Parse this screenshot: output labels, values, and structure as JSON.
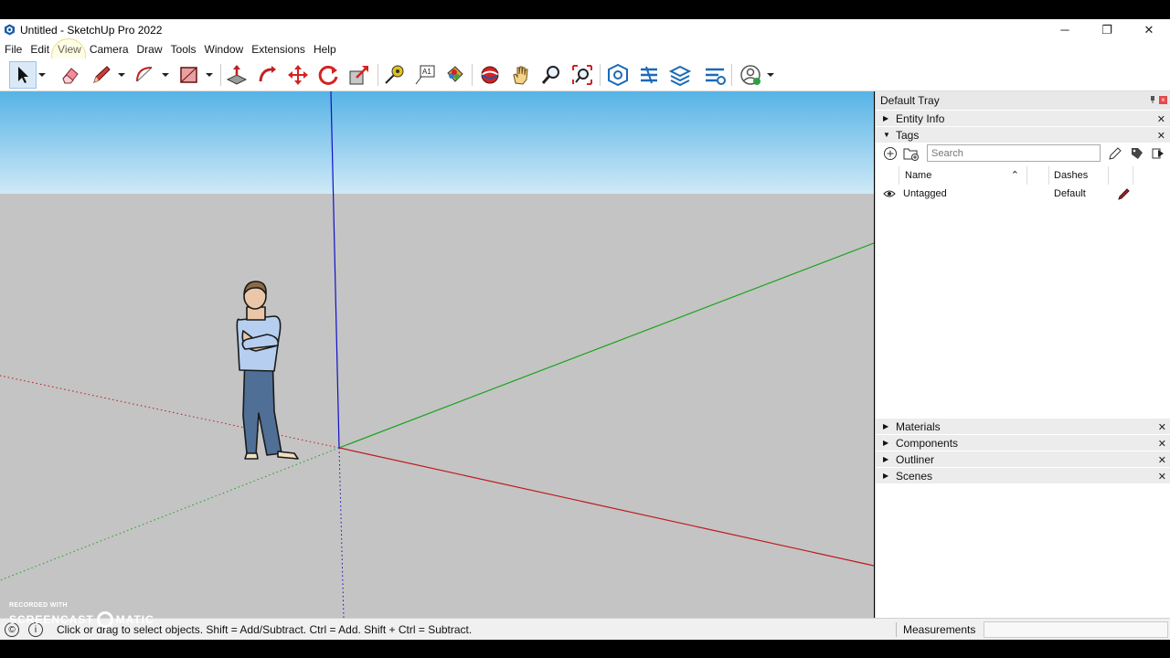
{
  "window": {
    "title": "Untitled - SketchUp Pro 2022",
    "minimize": "─",
    "restore": "❐",
    "close": "✕"
  },
  "menu": [
    "File",
    "Edit",
    "View",
    "Camera",
    "Draw",
    "Tools",
    "Window",
    "Extensions",
    "Help"
  ],
  "toolbar": {
    "tools": [
      "select-icon",
      "eraser-icon",
      "pencil-icon",
      "arc-icon",
      "rectangle-icon",
      "push-pull-icon",
      "follow-me-icon",
      "move-icon",
      "rotate-icon",
      "scale-icon",
      "tape-measure-icon",
      "text-icon",
      "paint-bucket-icon",
      "orbit-icon",
      "pan-icon",
      "zoom-icon",
      "zoom-extents-icon",
      "warehouse-icon",
      "extension-warehouse-icon",
      "layout-icon",
      "extension-manager-icon",
      "account-icon"
    ]
  },
  "tray": {
    "title": "Default Tray",
    "panels_top": [
      {
        "label": "Entity Info",
        "expanded": false
      },
      {
        "label": "Tags",
        "expanded": true
      }
    ],
    "tags": {
      "search_placeholder": "Search",
      "columns": {
        "name": "Name",
        "dashes": "Dashes"
      },
      "rows": [
        {
          "name": "Untagged",
          "dashes": "Default"
        }
      ]
    },
    "panels_bottom": [
      {
        "label": "Materials"
      },
      {
        "label": "Components"
      },
      {
        "label": "Outliner"
      },
      {
        "label": "Scenes"
      }
    ]
  },
  "status": {
    "hint": "Click or drag to select objects. Shift = Add/Subtract. Ctrl = Add. Shift + Ctrl = Subtract.",
    "measurements_label": "Measurements",
    "measurements_value": ""
  },
  "watermark": {
    "line1": "RECORDED WITH",
    "line2a": "SCREENCAST",
    "line2b": "MATIC"
  },
  "colors": {
    "sky_top": "#56b3e6",
    "sky_bottom": "#cfe9f7",
    "ground": "#c4c4c4",
    "axis_red": "#c0171b",
    "axis_green": "#1aa21a",
    "axis_blue": "#1010c8",
    "tray_header": "#e8e8e8",
    "tray_close": "#e04a4a"
  }
}
